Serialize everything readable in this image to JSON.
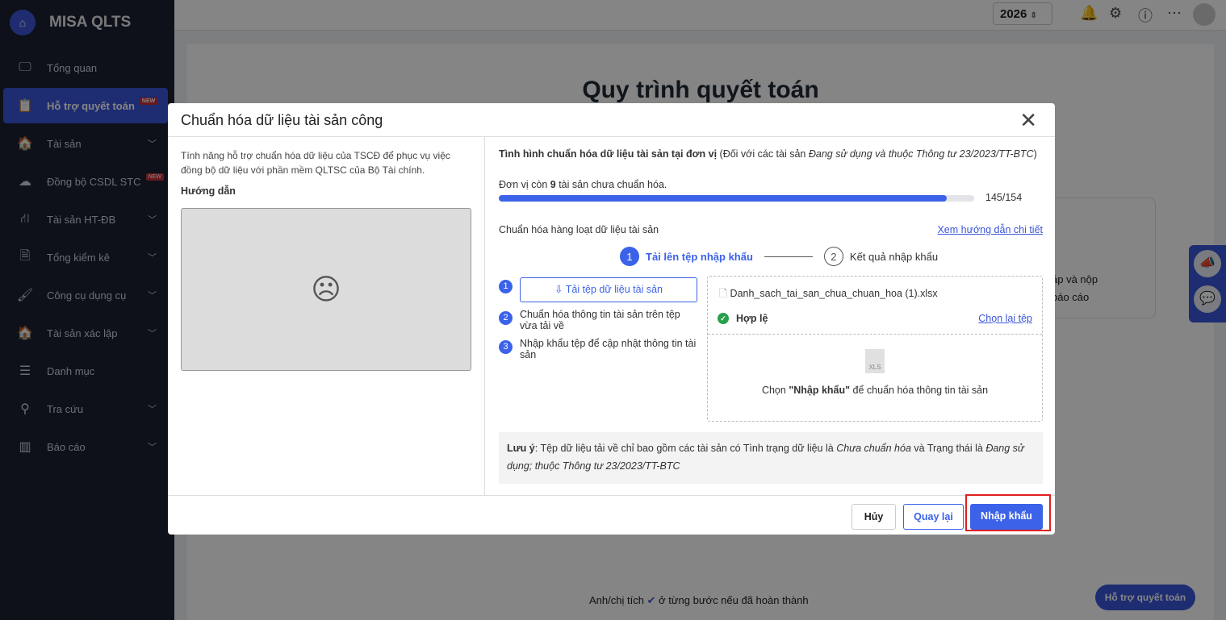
{
  "app": {
    "name": "MISA QLTS",
    "year": "2026"
  },
  "sidebar": {
    "items": [
      {
        "label": "Tổng quan",
        "icon": "chart-monitor-icon",
        "glyph": "🖵"
      },
      {
        "label": "Hỗ trợ quyết toán",
        "icon": "clipboard-icon",
        "glyph": "📋",
        "badge": "NEW",
        "active": true
      },
      {
        "label": "Tài sản",
        "icon": "house-car-icon",
        "glyph": "🏠",
        "chevron": true
      },
      {
        "label": "Đồng bộ CSDL STC",
        "icon": "cloud-upload-icon",
        "glyph": "☁",
        "badge": "NEW"
      },
      {
        "label": "Tài sản HT-ĐB",
        "icon": "road-icon",
        "glyph": "⛙",
        "chevron": true
      },
      {
        "label": "Tổng kiểm kê",
        "icon": "document-check-icon",
        "glyph": "🗎",
        "chevron": true
      },
      {
        "label": "Công cụ dụng cụ",
        "icon": "paint-roller-icon",
        "glyph": "🖌",
        "chevron": true
      },
      {
        "label": "Tài sản xác lập",
        "icon": "house-car-icon",
        "glyph": "🏠",
        "chevron": true
      },
      {
        "label": "Danh mục",
        "icon": "list-icon",
        "glyph": "☰"
      },
      {
        "label": "Tra cứu",
        "icon": "search-icon",
        "glyph": "⚲",
        "chevron": true
      },
      {
        "label": "Báo cáo",
        "icon": "bar-chart-icon",
        "glyph": "▥",
        "chevron": true
      }
    ]
  },
  "page": {
    "title": "Quy trình quyết toán",
    "card_text_1": "áp và nộp",
    "card_text_2": "báo cáo",
    "hint_before": "Anh/chị tích",
    "hint_after": "ở từng bước nếu đã hoàn thành",
    "support_button": "Hỗ trợ quyết toán"
  },
  "modal": {
    "title": "Chuẩn hóa dữ liệu tài sản công",
    "intro": "Tính năng hỗ trợ chuẩn hóa dữ liệu của TSCĐ để phục vụ việc đồng bộ dữ liệu với phần mềm QLTSC của Bộ Tài chính.",
    "guide_label": "Hướng dẫn",
    "status_title": "Tình hình chuẩn hóa dữ liệu tài sản tại đơn vị",
    "status_note_prefix": "(Đối với các tài sản ",
    "status_note_italic": "Đang sử dụng và thuộc Thông tư 23/2023/TT-BTC",
    "status_note_suffix": ")",
    "remaining_prefix": "Đơn vị còn ",
    "remaining_count": "9",
    "remaining_suffix": " tài sản chưa chuẩn hóa.",
    "progress": {
      "done": 145,
      "total": 154,
      "label": "145/154"
    },
    "batch_title": "Chuẩn hóa hàng loạt dữ liệu tài sản",
    "guide_link": "Xem hướng dẫn chi tiết",
    "stepper": [
      {
        "num": "1",
        "label": "Tải lên tệp nhập khẩu"
      },
      {
        "num": "2",
        "label": "Kết quả nhập khẩu"
      }
    ],
    "steps": [
      {
        "num": "1",
        "label": "Tải tệp dữ liệu tài sản"
      },
      {
        "num": "2",
        "label": "Chuẩn hóa thông tin tài sản trên tệp vừa tải về"
      },
      {
        "num": "3",
        "label": "Nhập khẩu tệp để cập nhật thông tin tài sản"
      }
    ],
    "file_name": "Danh_sach_tai_san_chua_chuan_hoa (1).xlsx",
    "valid_label": "Hợp lệ",
    "reselect_link": "Chọn lại tệp",
    "xls_tag": "XLS",
    "import_hint_prefix": "Chọn ",
    "import_hint_bold": "\"Nhập khẩu\"",
    "import_hint_suffix": " để chuẩn hóa thông tin tài sản",
    "note_label": "Lưu ý",
    "note_1": ": Tệp dữ liệu tải về chỉ bao gồm các tài sản có Tình trạng dữ liệu là ",
    "note_i1": "Chưa chuẩn hóa",
    "note_2": " và Trạng thái là ",
    "note_i2": "Đang sử dụng; thuộc Thông tư 23/2023/TT-BTC",
    "cancel": "Hủy",
    "back": "Quay lại",
    "import": "Nhập khẩu"
  },
  "colors": {
    "accent": "#3b62e8",
    "sidebar": "#1c2130",
    "highlight": "#e02020"
  }
}
